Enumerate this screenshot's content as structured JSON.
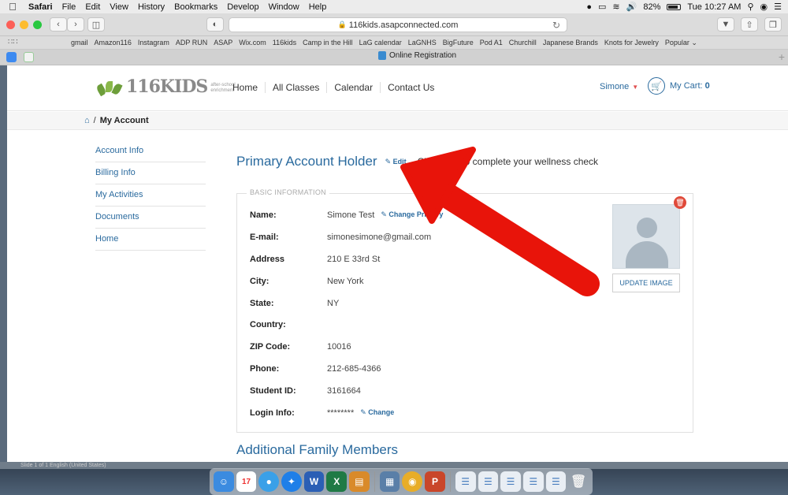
{
  "menubar": {
    "items": [
      "Safari",
      "File",
      "Edit",
      "View",
      "History",
      "Bookmarks",
      "Develop",
      "Window",
      "Help"
    ],
    "battery": "82%",
    "clock": "Tue 10:27 AM"
  },
  "browser": {
    "url": "116kids.asapconnected.com",
    "bookmarks": [
      "gmail",
      "Amazon116",
      "Instagram",
      "ADP RUN",
      "ASAP",
      "Wix.com",
      "116kids",
      "Camp in the Hill",
      "LaG calendar",
      "LaGNHS",
      "BigFuture",
      "Pod A1",
      "Churchill",
      "Japanese Brands",
      "Knots for Jewelry",
      "Popular ⌄"
    ],
    "tab_title": "Online Registration"
  },
  "site": {
    "logo_text": "116KIDS",
    "logo_tagline": "after-school enrichment",
    "nav": [
      "Home",
      "All Classes",
      "Calendar",
      "Contact Us"
    ],
    "user_name": "Simone",
    "cart_label": "My Cart: ",
    "cart_count": "0"
  },
  "breadcrumb": {
    "separator": "/",
    "current": "My Account"
  },
  "sidebar": {
    "items": [
      "Account Info",
      "Billing Info",
      "My Activities",
      "Documents",
      "Home"
    ]
  },
  "account": {
    "heading": "Primary Account Holder",
    "edit_label": "Edit",
    "wellness_text": "Click here to complete your wellness check",
    "section_legend": "BASIC INFORMATION",
    "change_primary_label": "Change Primary",
    "change_label": "Change",
    "update_image_label": "UPDATE IMAGE",
    "fields": [
      {
        "label": "Name:",
        "value": "Simone Test"
      },
      {
        "label": "E-mail:",
        "value": "simonesimone@gmail.com"
      },
      {
        "label": "Address",
        "value": "210 E 33rd St"
      },
      {
        "label": "City:",
        "value": "New York"
      },
      {
        "label": "State:",
        "value": "NY"
      },
      {
        "label": "Country:",
        "value": ""
      },
      {
        "label": "ZIP Code:",
        "value": "10016"
      },
      {
        "label": "Phone:",
        "value": "212-685-4366"
      },
      {
        "label": "Student ID:",
        "value": "3161664"
      },
      {
        "label": "Login Info:",
        "value": "********"
      }
    ],
    "family_heading": "Additional Family Members"
  },
  "background_window_status": "Slide 1 of 1    English (United States)",
  "colors": {
    "link_blue": "#2a6a9e",
    "annotation_red": "#e8140a",
    "delete_red": "#e04a3a"
  }
}
